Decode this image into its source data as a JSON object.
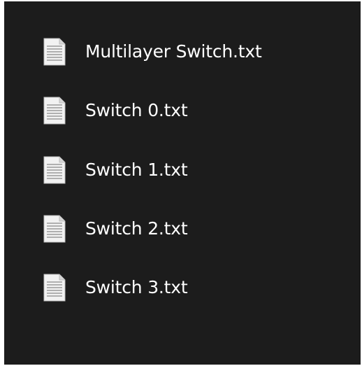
{
  "colors": {
    "background": "#1c1c1c",
    "text": "#ffffff",
    "icon_page": "#f2f2f2",
    "icon_lines": "#9a9a9a"
  },
  "files": [
    {
      "name": "Multilayer Switch.txt",
      "icon": "text-file-icon"
    },
    {
      "name": "Switch 0.txt",
      "icon": "text-file-icon"
    },
    {
      "name": "Switch 1.txt",
      "icon": "text-file-icon"
    },
    {
      "name": "Switch 2.txt",
      "icon": "text-file-icon"
    },
    {
      "name": "Switch 3.txt",
      "icon": "text-file-icon"
    }
  ]
}
